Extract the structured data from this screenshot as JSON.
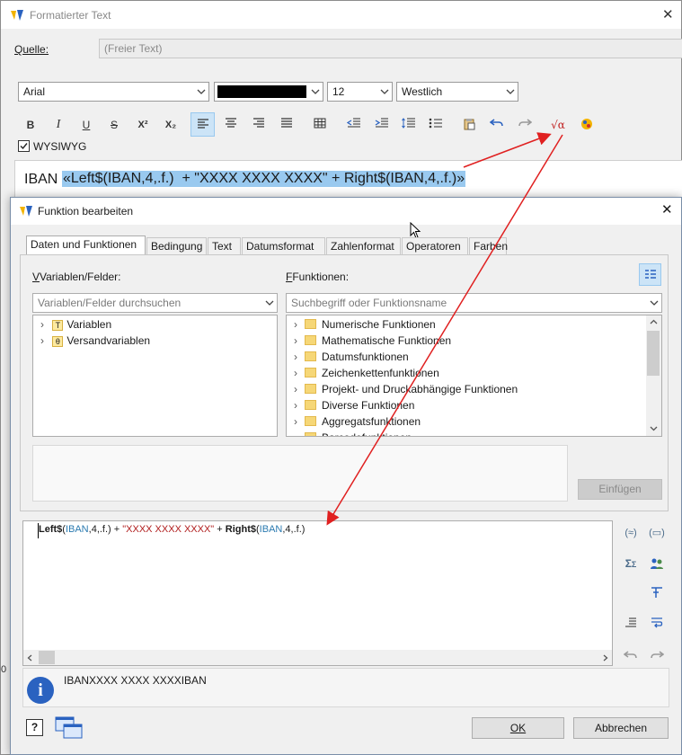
{
  "outer_window": {
    "title": "Formatierter Text",
    "source_label": "Quelle:",
    "source_value": "(Freier Text)",
    "font_family": "Arial",
    "font_size": "12",
    "script": "Westlich",
    "wysiwyg_label": "WYSIWYG",
    "editor_prefix": "IBAN",
    "editor_formula": "«Left$(IBAN,4,.f.)  + \"XXXX XXXX XXXX\" + Right$(IBAN,4,.f.)»",
    "formula_highlight_color": "#99c9ef",
    "toolbar": {
      "bold": "B",
      "italic": "I",
      "underline": "U",
      "strike": "S",
      "superscript": "X²",
      "subscript": "X₂",
      "formula_icon": "√α"
    }
  },
  "dialog": {
    "title": "Funktion bearbeiten",
    "tabs": [
      "Daten und Funktionen",
      "Bedingung",
      "Text",
      "Datumsformat",
      "Zahlenformat",
      "Operatoren",
      "Farben"
    ],
    "vars_label": "Variablen/Felder:",
    "vars_search_placeholder": "Variablen/Felder durchsuchen",
    "vars_tree": [
      "Variablen",
      "Versandvariablen"
    ],
    "funcs_label": "Funktionen:",
    "funcs_search_placeholder": "Suchbegriff oder Funktionsname",
    "funcs_tree": [
      "Numerische Funktionen",
      "Mathematische Funktionen",
      "Datumsfunktionen",
      "Zeichenkettenfunktionen",
      "Projekt- und Druckabhängige Funktionen",
      "Diverse Funktionen",
      "Aggregatsfunktionen",
      "Barcodefunktionen"
    ],
    "insert_button": "Einfügen",
    "expression": {
      "left_func": "Left$",
      "open1": "(",
      "arg1": "IBAN",
      "rest1": ",4,.f.)",
      "plus1": " + ",
      "literal": "\"XXXX XXXX XXXX\"",
      "plus2": " + ",
      "right_func": "Right$",
      "open2": "(",
      "arg2": "IBAN",
      "rest2": ",4,.f.)"
    },
    "result_preview": "IBANXXXX XXXX XXXXIBAN",
    "ok_button": "OK",
    "cancel_button": "Abbrechen",
    "colors": {
      "variable": "#2a7ab0",
      "literal": "#b01c1c",
      "arrow": "#e02020",
      "selected_tab_bg": "#ffffff",
      "info_icon": "#2a62c0"
    }
  }
}
